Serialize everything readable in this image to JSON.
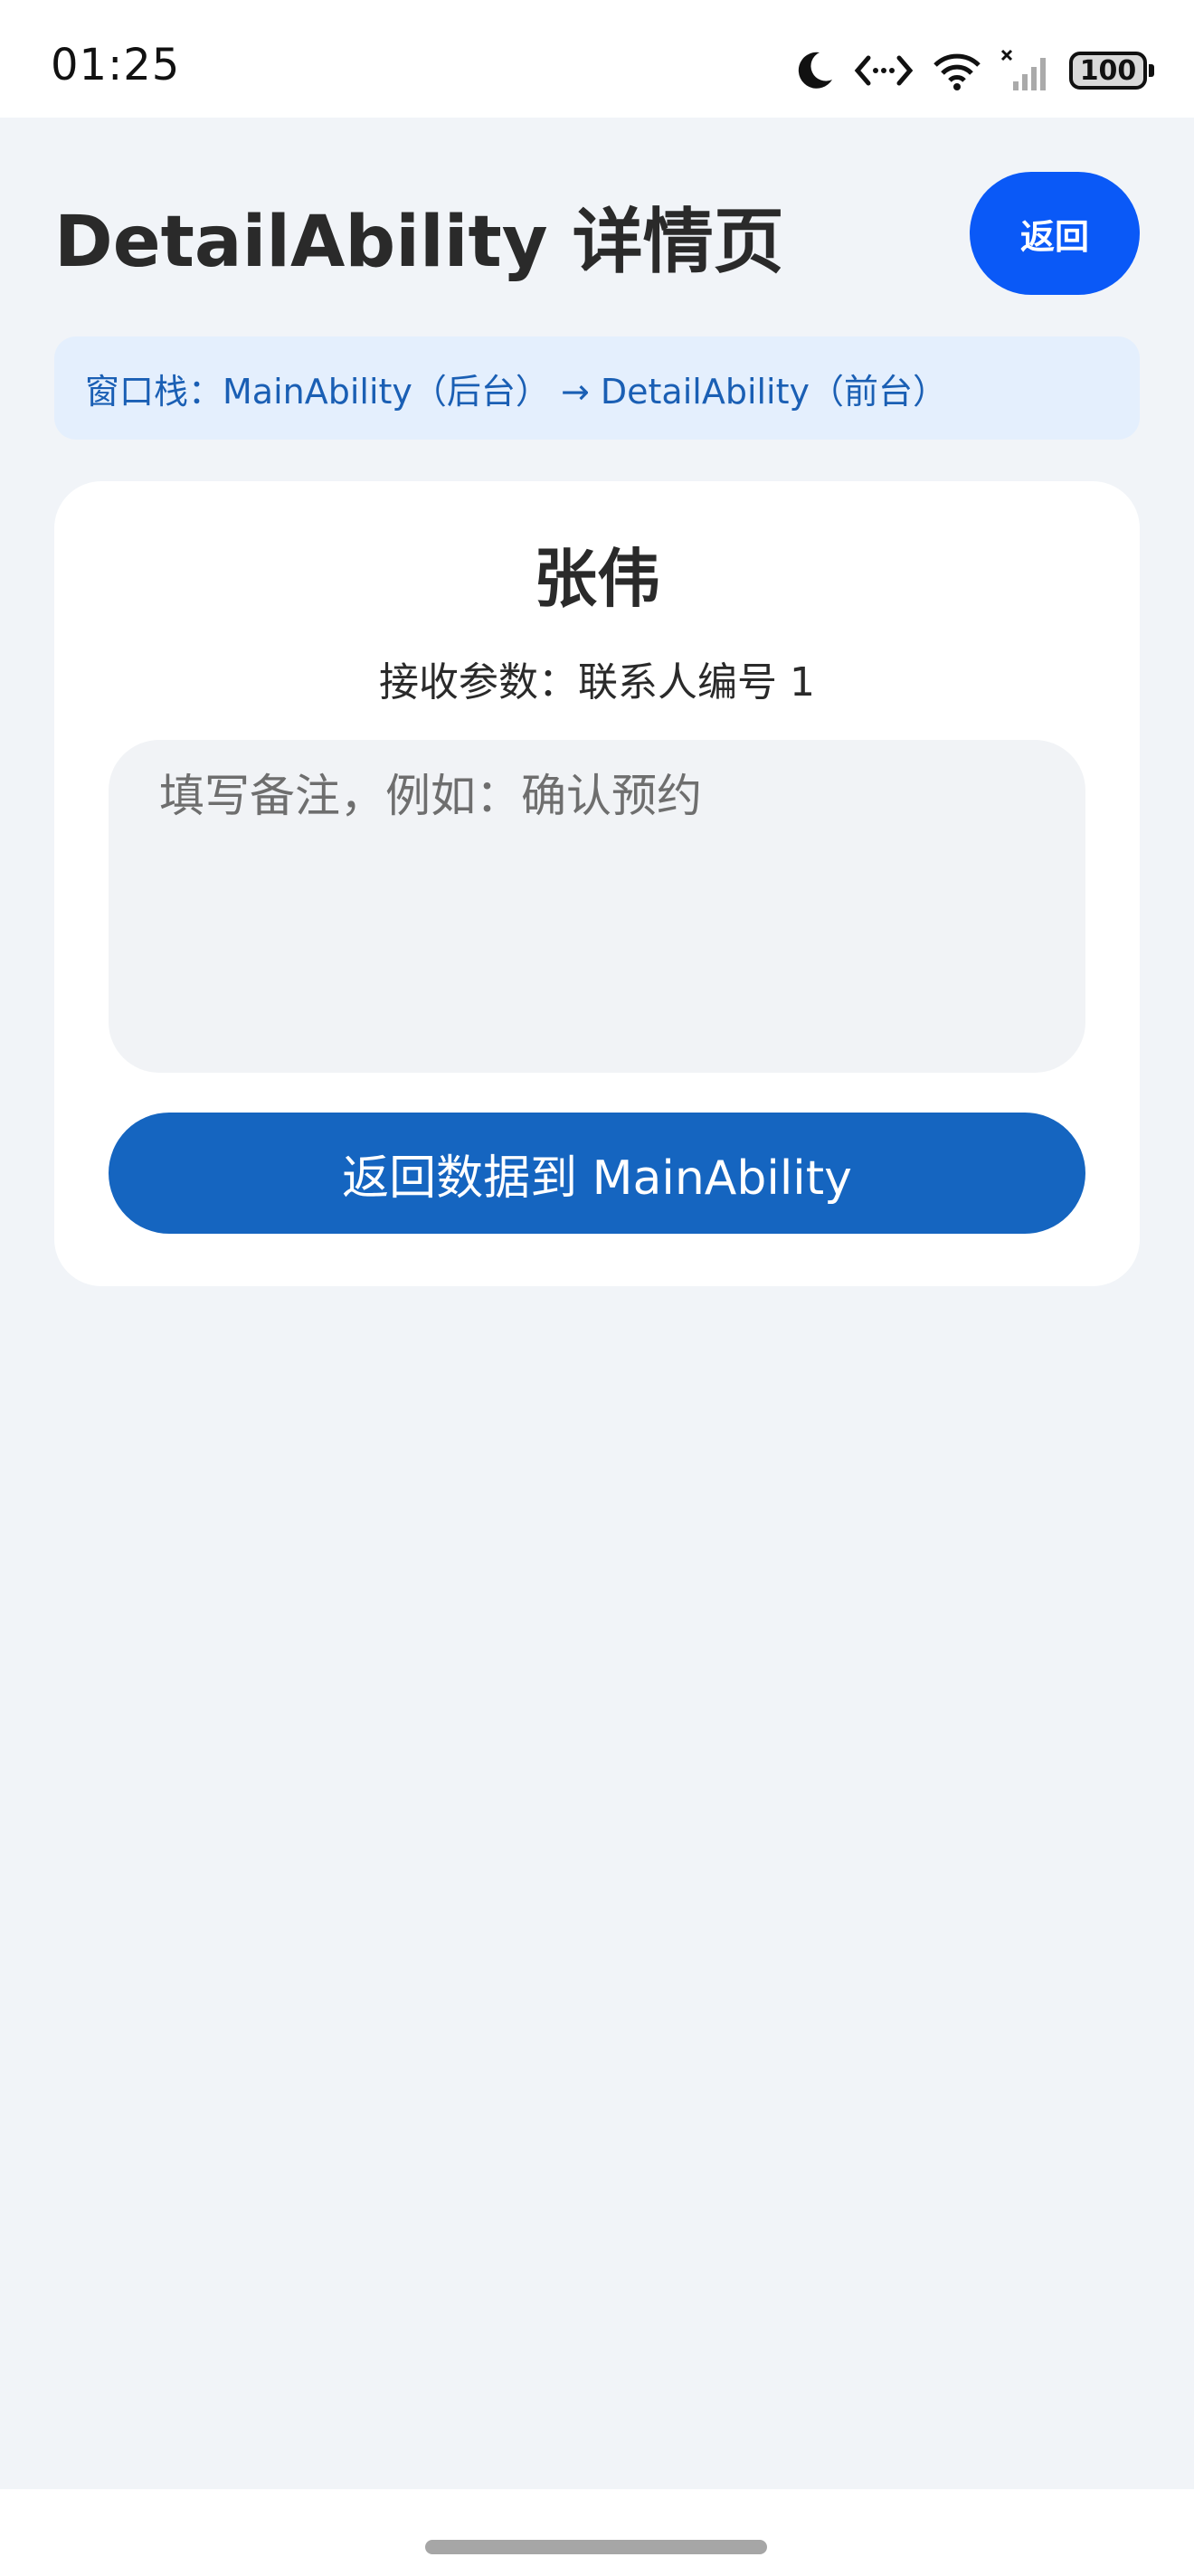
{
  "status_bar": {
    "time": "01:25",
    "icons": [
      "moon-icon",
      "code-arrows-icon",
      "wifi-icon",
      "signal-no-sim-icon",
      "battery-icon"
    ],
    "battery_level": "100"
  },
  "header": {
    "title": "DetailAbility 详情页",
    "back_label": "返回"
  },
  "stack_banner": {
    "text": "窗口栈：MainAbility（后台） → DetailAbility（前台）"
  },
  "card": {
    "name": "张伟",
    "param_text": "接收参数：联系人编号 1",
    "note_value": "",
    "note_placeholder": "填写备注，例如：确认预约",
    "submit_label": "返回数据到 MainAbility"
  },
  "colors": {
    "background": "#f1f4f8",
    "accent": "#0a59f7",
    "submit": "#1565c0",
    "banner_bg": "#e4effd",
    "banner_text": "#1a5fb4"
  }
}
